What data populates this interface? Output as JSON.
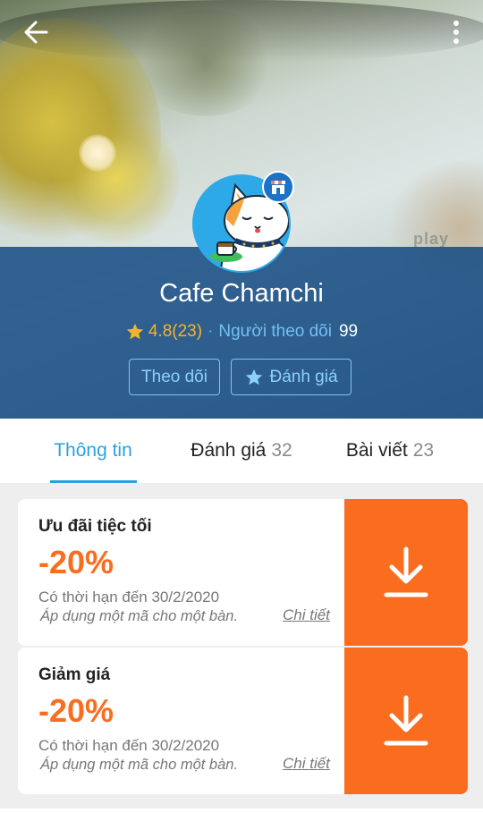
{
  "header": {
    "shop_name": "Cafe Chamchi",
    "rating": "4.8(23)",
    "separator": "·",
    "followers_label": "Người theo dõi",
    "followers_count": "99",
    "follow_label": "Theo dõi",
    "rate_label": "Đánh giá",
    "cover_hint": "play"
  },
  "tabs": [
    {
      "label": "Thông tin",
      "count": ""
    },
    {
      "label": "Đánh giá",
      "count": "32"
    },
    {
      "label": "Bài viết",
      "count": "23"
    }
  ],
  "coupons": [
    {
      "title": "Ưu đãi tiệc tối",
      "discount": "-20%",
      "expiry": "Có thời hạn đến 30/2/2020",
      "note": "Áp dụng một mã cho một bàn.",
      "detail_label": "Chi tiết"
    },
    {
      "title": "Giảm giá",
      "discount": "-20%",
      "expiry": "Có thời hạn đến 30/2/2020",
      "note": "Áp dụng một mã cho một bàn.",
      "detail_label": "Chi tiết"
    }
  ],
  "icons": {
    "back": "arrow-left-icon",
    "more": "more-vertical-icon",
    "star": "star-icon",
    "download": "download-icon",
    "shop": "shop-icon"
  },
  "colors": {
    "accent_blue": "#2ba2de",
    "orange": "#fa6d1e",
    "rating_gold": "#f5b428",
    "panel_blue": "#144b82"
  }
}
